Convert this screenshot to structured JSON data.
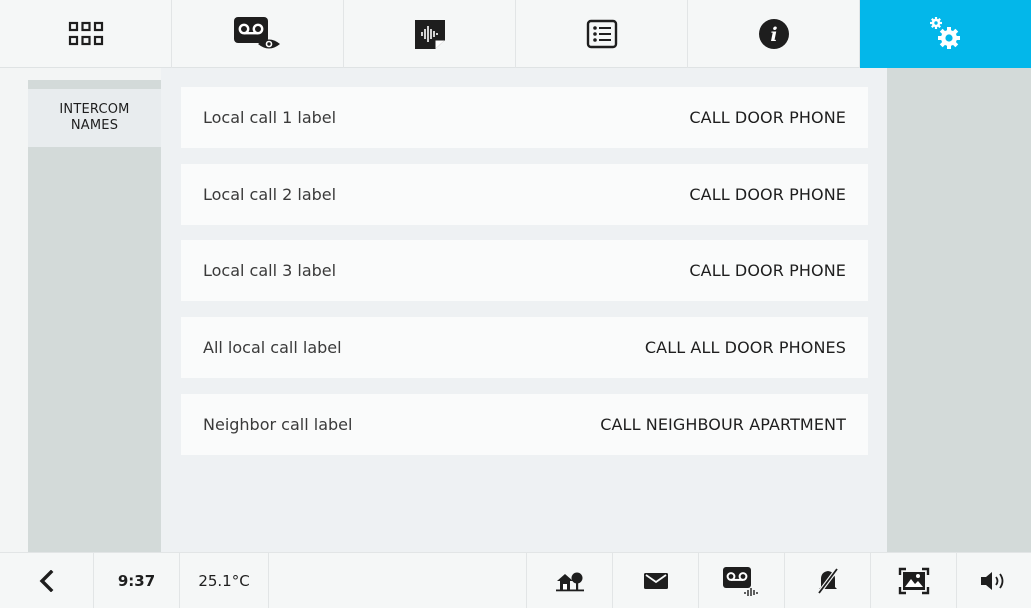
{
  "top_tabs": [
    {
      "icon": "grid-icon",
      "active": false
    },
    {
      "icon": "voicemail-view-icon",
      "active": false
    },
    {
      "icon": "audio-note-icon",
      "active": false
    },
    {
      "icon": "list-icon",
      "active": false
    },
    {
      "icon": "info-icon",
      "active": false
    },
    {
      "icon": "settings-gears-icon",
      "active": true
    }
  ],
  "sidebar": {
    "selected_item": {
      "line1": "INTERCOM",
      "line2": "NAMES"
    }
  },
  "rows": [
    {
      "label": "Local call 1 label",
      "value": "CALL DOOR PHONE"
    },
    {
      "label": "Local call 2 label",
      "value": "CALL DOOR PHONE"
    },
    {
      "label": "Local call 3 label",
      "value": "CALL DOOR PHONE"
    },
    {
      "label": "All local call label",
      "value": "CALL ALL DOOR PHONES"
    },
    {
      "label": "Neighbor call label",
      "value": "CALL NEIGHBOUR APARTMENT"
    }
  ],
  "status_bar": {
    "back_icon": "chevron-left-icon",
    "time": "9:37",
    "temperature": "25.1°C",
    "icons": [
      "home-tree-icon",
      "envelope-icon",
      "voicemail-audio-icon",
      "bell-muted-icon",
      "image-frame-icon",
      "speaker-icon"
    ]
  },
  "colors": {
    "accent": "#03b7ea",
    "panel_grey": "#d3dad9",
    "content_bg": "#eef1f3",
    "row_bg": "#fafbfb"
  }
}
